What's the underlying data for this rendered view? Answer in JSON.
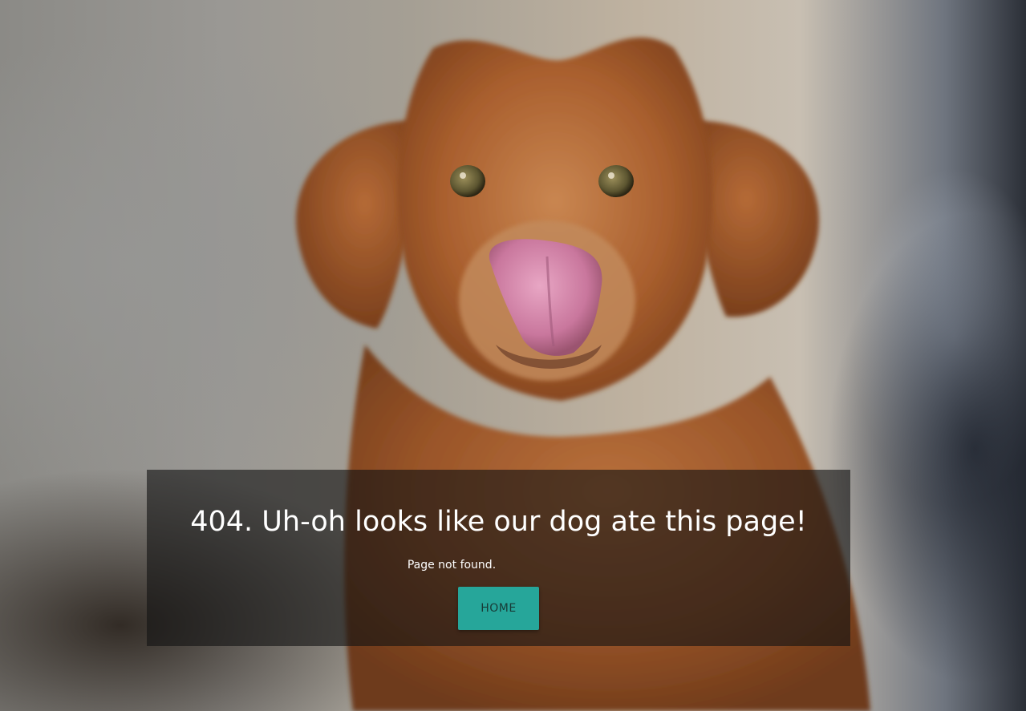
{
  "hero": {
    "image_subject": "dog-licking-nose-photo"
  },
  "error": {
    "heading": "404. Uh-oh looks like our dog ate this page!",
    "message": "Page not found."
  },
  "actions": {
    "home_label": "HOME"
  },
  "colors": {
    "button_bg": "#26a69a",
    "overlay_bg": "rgba(20,20,20,0.62)",
    "text": "#ffffff"
  }
}
